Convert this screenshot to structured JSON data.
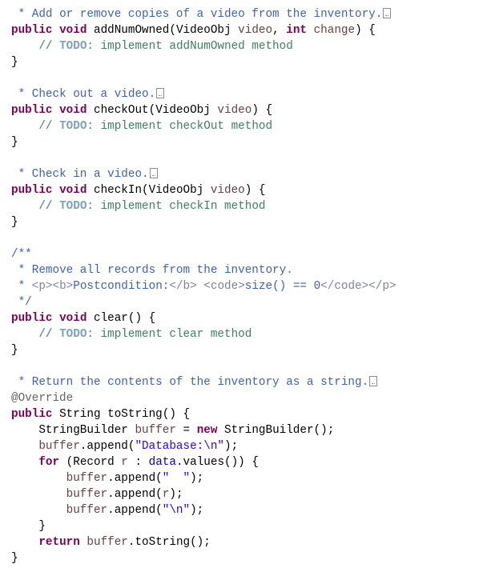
{
  "editor": {
    "language": "java",
    "lines": [
      {
        "indent": " ",
        "tokens": [
          {
            "t": "* Add or remove copies of a video from the inventory.",
            "c": "jd"
          }
        ],
        "folded": true
      },
      {
        "indent": "",
        "tokens": [
          {
            "t": "public",
            "c": "kw"
          },
          {
            "t": " ",
            "c": ""
          },
          {
            "t": "void",
            "c": "kw"
          },
          {
            "t": " addNumOwned(VideoObj ",
            "c": ""
          },
          {
            "t": "video",
            "c": "var"
          },
          {
            "t": ", ",
            "c": ""
          },
          {
            "t": "int",
            "c": "kw"
          },
          {
            "t": " ",
            "c": ""
          },
          {
            "t": "change",
            "c": "var"
          },
          {
            "t": ") {",
            "c": ""
          }
        ]
      },
      {
        "indent": "    ",
        "tokens": [
          {
            "t": "// ",
            "c": "cm"
          },
          {
            "t": "TODO",
            "c": "todo"
          },
          {
            "t": ": implement addNumOwned method",
            "c": "cm"
          }
        ]
      },
      {
        "indent": "",
        "tokens": [
          {
            "t": "}",
            "c": ""
          }
        ]
      },
      {
        "indent": "",
        "tokens": []
      },
      {
        "indent": " ",
        "tokens": [
          {
            "t": "* Check out a video.",
            "c": "jd"
          }
        ],
        "folded": true
      },
      {
        "indent": "",
        "tokens": [
          {
            "t": "public",
            "c": "kw"
          },
          {
            "t": " ",
            "c": ""
          },
          {
            "t": "void",
            "c": "kw"
          },
          {
            "t": " checkOut(VideoObj ",
            "c": ""
          },
          {
            "t": "video",
            "c": "var"
          },
          {
            "t": ") {",
            "c": ""
          }
        ]
      },
      {
        "indent": "    ",
        "tokens": [
          {
            "t": "// ",
            "c": "cm"
          },
          {
            "t": "TODO",
            "c": "todo"
          },
          {
            "t": ": implement checkOut method",
            "c": "cm"
          }
        ]
      },
      {
        "indent": "",
        "tokens": [
          {
            "t": "}",
            "c": ""
          }
        ]
      },
      {
        "indent": "",
        "tokens": []
      },
      {
        "indent": " ",
        "tokens": [
          {
            "t": "* Check in a video.",
            "c": "jd"
          }
        ],
        "folded": true
      },
      {
        "indent": "",
        "tokens": [
          {
            "t": "public",
            "c": "kw"
          },
          {
            "t": " ",
            "c": ""
          },
          {
            "t": "void",
            "c": "kw"
          },
          {
            "t": " checkIn(VideoObj ",
            "c": ""
          },
          {
            "t": "video",
            "c": "var"
          },
          {
            "t": ") {",
            "c": ""
          }
        ]
      },
      {
        "indent": "    ",
        "tokens": [
          {
            "t": "// ",
            "c": "cm"
          },
          {
            "t": "TODO",
            "c": "todo"
          },
          {
            "t": ": implement checkIn method",
            "c": "cm"
          }
        ]
      },
      {
        "indent": "",
        "tokens": [
          {
            "t": "}",
            "c": ""
          }
        ]
      },
      {
        "indent": "",
        "tokens": []
      },
      {
        "indent": "",
        "tokens": [
          {
            "t": "/**",
            "c": "jd"
          }
        ]
      },
      {
        "indent": " ",
        "tokens": [
          {
            "t": "* Remove all records from the inventory.",
            "c": "jd"
          }
        ]
      },
      {
        "indent": " ",
        "tokens": [
          {
            "t": "* ",
            "c": "jd"
          },
          {
            "t": "<p><b>",
            "c": "jdtag"
          },
          {
            "t": "Postcondition:",
            "c": "jd"
          },
          {
            "t": "</b>",
            "c": "jdtag"
          },
          {
            "t": " ",
            "c": "jd"
          },
          {
            "t": "<code>",
            "c": "jdtag"
          },
          {
            "t": "size() == 0",
            "c": "jd"
          },
          {
            "t": "</code></p>",
            "c": "jdtag"
          }
        ]
      },
      {
        "indent": " ",
        "tokens": [
          {
            "t": "*/",
            "c": "jd"
          }
        ]
      },
      {
        "indent": "",
        "tokens": [
          {
            "t": "public",
            "c": "kw"
          },
          {
            "t": " ",
            "c": ""
          },
          {
            "t": "void",
            "c": "kw"
          },
          {
            "t": " clear() {",
            "c": ""
          }
        ]
      },
      {
        "indent": "    ",
        "tokens": [
          {
            "t": "// ",
            "c": "cm"
          },
          {
            "t": "TODO",
            "c": "todo"
          },
          {
            "t": ": implement clear method",
            "c": "cm"
          }
        ]
      },
      {
        "indent": "",
        "tokens": [
          {
            "t": "}",
            "c": ""
          }
        ]
      },
      {
        "indent": "",
        "tokens": []
      },
      {
        "indent": " ",
        "tokens": [
          {
            "t": "* Return the contents of the inventory as a string.",
            "c": "jd"
          }
        ],
        "folded": true
      },
      {
        "indent": "",
        "tokens": [
          {
            "t": "@Override",
            "c": "ann"
          }
        ]
      },
      {
        "indent": "",
        "tokens": [
          {
            "t": "public",
            "c": "kw"
          },
          {
            "t": " String toString() {",
            "c": ""
          }
        ]
      },
      {
        "indent": "    ",
        "tokens": [
          {
            "t": "StringBuilder ",
            "c": ""
          },
          {
            "t": "buffer",
            "c": "var"
          },
          {
            "t": " = ",
            "c": ""
          },
          {
            "t": "new",
            "c": "kw"
          },
          {
            "t": " StringBuilder();",
            "c": ""
          }
        ]
      },
      {
        "indent": "    ",
        "tokens": [
          {
            "t": "buffer",
            "c": "var"
          },
          {
            "t": ".append(",
            "c": ""
          },
          {
            "t": "\"Database:\\n\"",
            "c": "str"
          },
          {
            "t": ");",
            "c": ""
          }
        ]
      },
      {
        "indent": "    ",
        "tokens": [
          {
            "t": "for",
            "c": "kw"
          },
          {
            "t": " (Record ",
            "c": ""
          },
          {
            "t": "r",
            "c": "var"
          },
          {
            "t": " : ",
            "c": ""
          },
          {
            "t": "data",
            "c": "fld"
          },
          {
            "t": ".values()) {",
            "c": ""
          }
        ]
      },
      {
        "indent": "        ",
        "tokens": [
          {
            "t": "buffer",
            "c": "var"
          },
          {
            "t": ".append(",
            "c": ""
          },
          {
            "t": "\"  \"",
            "c": "str"
          },
          {
            "t": ");",
            "c": ""
          }
        ]
      },
      {
        "indent": "        ",
        "tokens": [
          {
            "t": "buffer",
            "c": "var"
          },
          {
            "t": ".append(",
            "c": ""
          },
          {
            "t": "r",
            "c": "var"
          },
          {
            "t": ");",
            "c": ""
          }
        ]
      },
      {
        "indent": "        ",
        "tokens": [
          {
            "t": "buffer",
            "c": "var"
          },
          {
            "t": ".append(",
            "c": ""
          },
          {
            "t": "\"\\n\"",
            "c": "str"
          },
          {
            "t": ");",
            "c": ""
          }
        ]
      },
      {
        "indent": "    ",
        "tokens": [
          {
            "t": "}",
            "c": ""
          }
        ]
      },
      {
        "indent": "    ",
        "tokens": [
          {
            "t": "return",
            "c": "kw"
          },
          {
            "t": " ",
            "c": ""
          },
          {
            "t": "buffer",
            "c": "var"
          },
          {
            "t": ".toString();",
            "c": ""
          }
        ]
      },
      {
        "indent": "",
        "tokens": [
          {
            "t": "}",
            "c": ""
          }
        ]
      }
    ]
  },
  "colors": {
    "keyword": "#7f0055",
    "javadoc": "#3f5fbf",
    "javadoc_tag": "#7f7f9f",
    "comment": "#3f7f5f",
    "todo": "#7f9fbf",
    "string": "#2a00ff",
    "field": "#0000c0",
    "local_variable": "#6a3e3e",
    "annotation": "#646464"
  }
}
